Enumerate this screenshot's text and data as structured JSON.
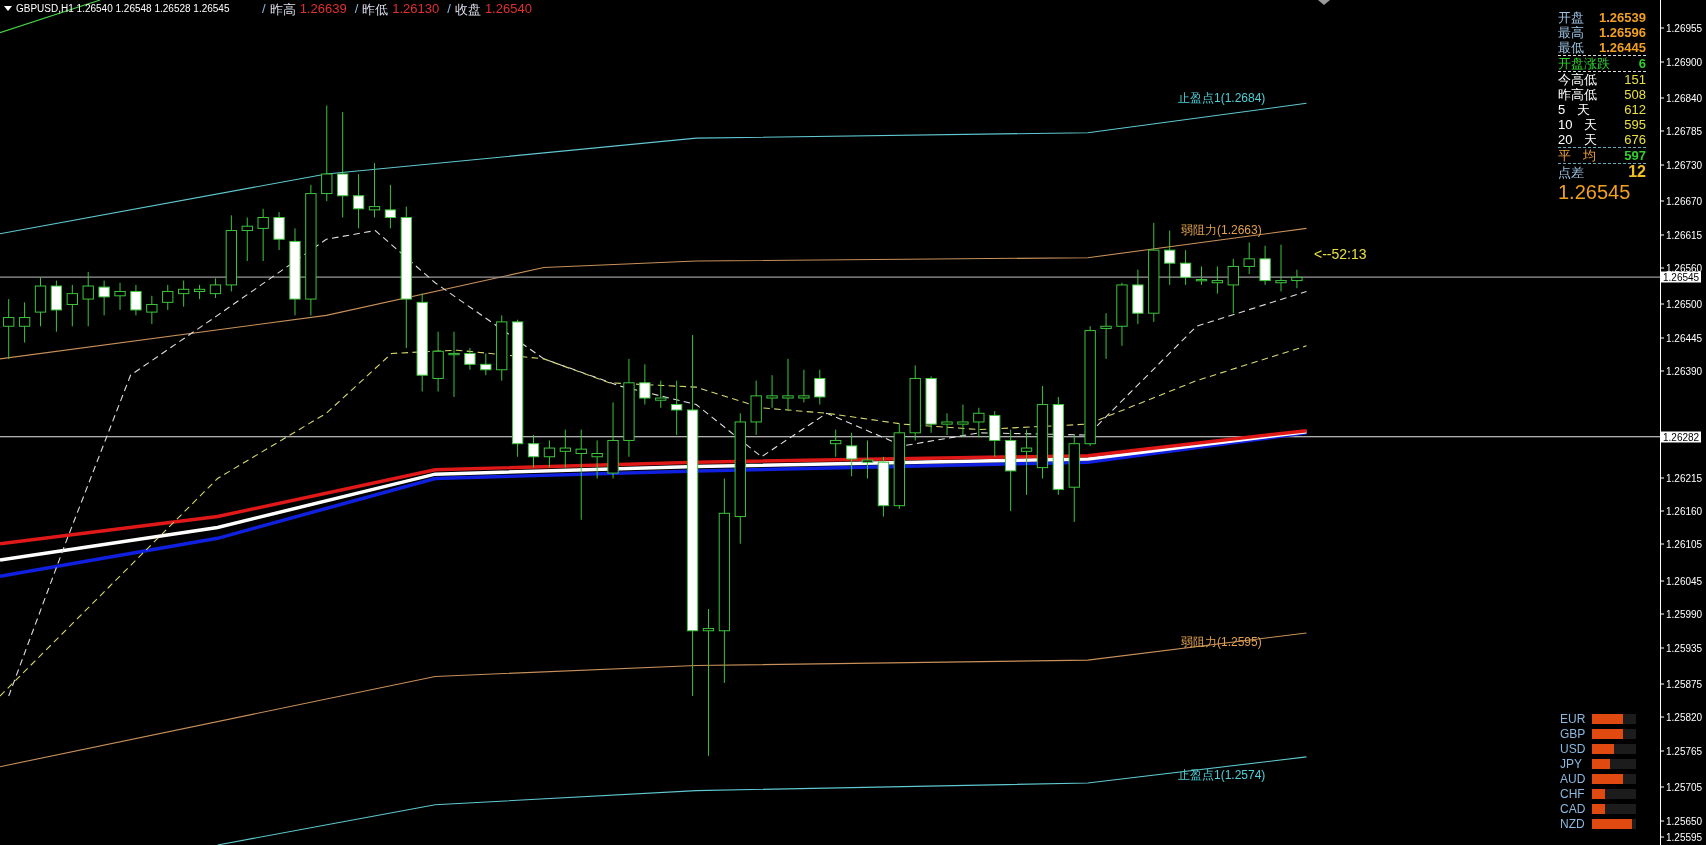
{
  "header": {
    "symbol": "GBPUSD,H1 1.26540 1.26548 1.26528 1.26545",
    "stats": [
      {
        "mark": "/",
        "label": "昨高",
        "value": "1.26639"
      },
      {
        "mark": "/",
        "label": "昨低",
        "value": "1.26130"
      },
      {
        "mark": "/",
        "label": "收盘",
        "value": "1.26540"
      }
    ]
  },
  "level_labels": [
    {
      "kind": "take_profit",
      "text": "止盈点1(1.2684)"
    },
    {
      "kind": "resistance",
      "text": "弱阻力(1.2663)"
    },
    {
      "kind": "resistance",
      "text": "弱阻力(1.2595)"
    },
    {
      "kind": "take_profit",
      "text": "止盈点1(1.2574)"
    }
  ],
  "countdown": "<--52:13",
  "info_panel": {
    "rows": [
      {
        "kind": "ohlc",
        "label": "开盘",
        "value": "1.26539"
      },
      {
        "kind": "ohlc",
        "label": "最高",
        "value": "1.26596"
      },
      {
        "kind": "ohlc",
        "label": "最低",
        "value": "1.26445"
      },
      {
        "kind": "change",
        "label": "开盘涨跌",
        "value": "6"
      },
      {
        "kind": "range",
        "label": "今高低",
        "value": "151"
      },
      {
        "kind": "range",
        "label": "昨高低",
        "value": "508"
      },
      {
        "kind": "range",
        "label": "5 天",
        "value": "612"
      },
      {
        "kind": "range",
        "label": "10 天",
        "value": "595"
      },
      {
        "kind": "range",
        "label": "20 天",
        "value": "676"
      },
      {
        "kind": "average",
        "label": "平 均",
        "value": "597"
      },
      {
        "kind": "spread",
        "label": "点差",
        "value": "12"
      }
    ],
    "price": "1.26545"
  },
  "currency_strength": [
    {
      "currency": "EUR",
      "level": 0.7
    },
    {
      "currency": "GBP",
      "level": 0.7
    },
    {
      "currency": "USD",
      "level": 0.5
    },
    {
      "currency": "JPY",
      "level": 0.4
    },
    {
      "currency": "AUD",
      "level": 0.7
    },
    {
      "currency": "CHF",
      "level": 0.3
    },
    {
      "currency": "CAD",
      "level": 0.3
    },
    {
      "currency": "NZD",
      "level": 0.9
    }
  ],
  "price_axis": {
    "ticks": [
      "1.26955",
      "1.26900",
      "1.26840",
      "1.26785",
      "1.26730",
      "1.26670",
      "1.26615",
      "1.26560",
      "1.26500",
      "1.26445",
      "1.26390",
      "1.26215",
      "1.26160",
      "1.26105",
      "1.26045",
      "1.25990",
      "1.25935",
      "1.25875",
      "1.25820",
      "1.25765",
      "1.25705",
      "1.25650",
      "1.25595"
    ],
    "price_labels": [
      {
        "text": "1.26545"
      },
      {
        "text": "1.26282"
      }
    ]
  }
}
